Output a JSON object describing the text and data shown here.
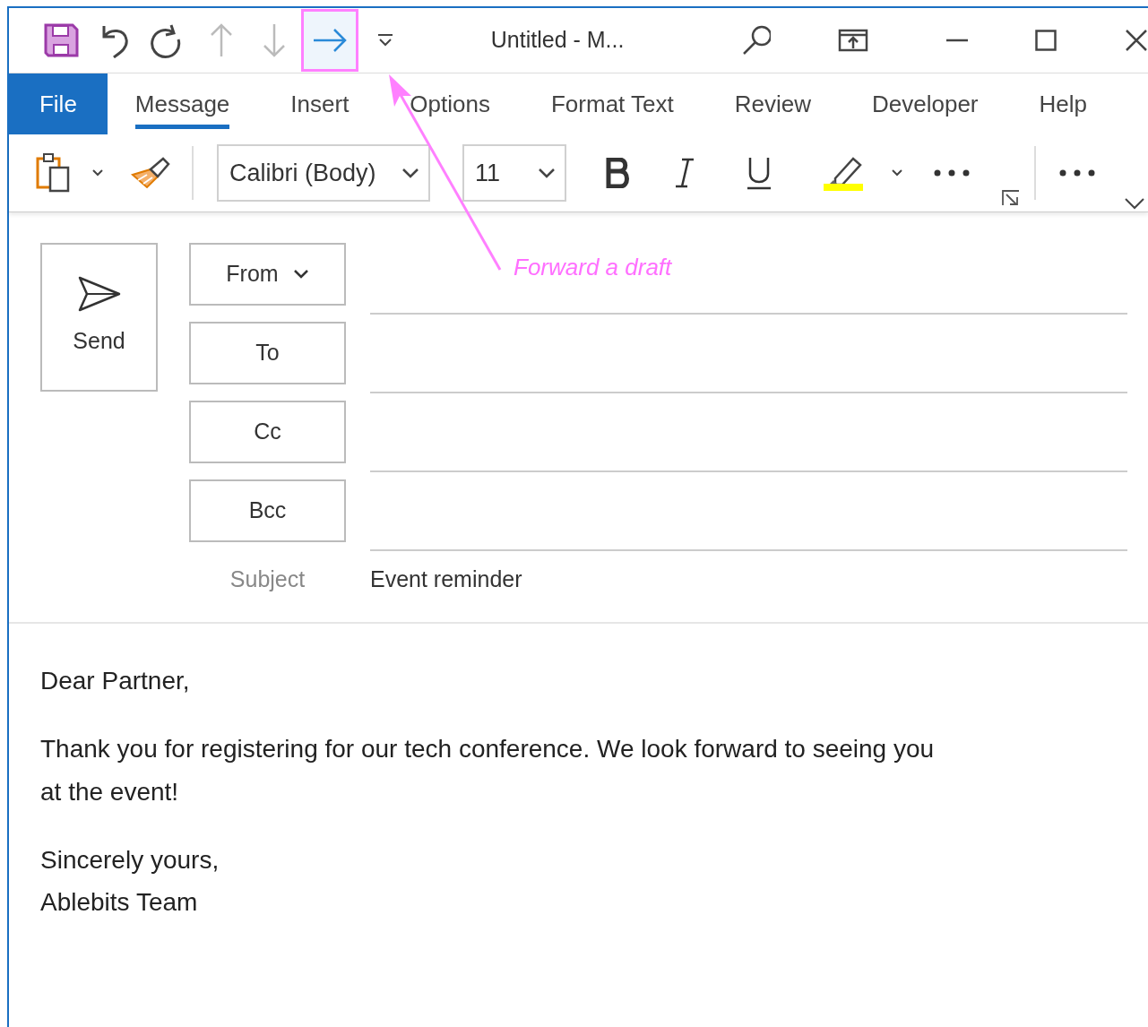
{
  "window": {
    "title": "Untitled  -  M..."
  },
  "quick_access": [
    {
      "kind": "save",
      "disabled": false,
      "highlighted": false
    },
    {
      "kind": "undo",
      "disabled": false,
      "highlighted": false
    },
    {
      "kind": "redo",
      "disabled": false,
      "highlighted": false
    },
    {
      "kind": "up",
      "disabled": true,
      "highlighted": false
    },
    {
      "kind": "down",
      "disabled": true,
      "highlighted": false
    },
    {
      "kind": "forward",
      "disabled": false,
      "highlighted": true
    },
    {
      "kind": "customize",
      "disabled": false,
      "highlighted": false
    }
  ],
  "tabs": [
    {
      "label": "File",
      "kind": "file",
      "selected": false
    },
    {
      "label": "Message",
      "kind": "tab",
      "selected": true
    },
    {
      "label": "Insert",
      "kind": "tab",
      "selected": false
    },
    {
      "label": "Options",
      "kind": "tab",
      "selected": false
    },
    {
      "label": "Format Text",
      "kind": "tab",
      "selected": false
    },
    {
      "label": "Review",
      "kind": "tab",
      "selected": false
    },
    {
      "label": "Developer",
      "kind": "tab",
      "selected": false
    },
    {
      "label": "Help",
      "kind": "tab",
      "selected": false
    }
  ],
  "ribbon": {
    "font": "Calibri (Body)",
    "size": "11"
  },
  "send_button": "Send",
  "address_fields": [
    {
      "label": "From",
      "kind": "dropdown"
    },
    {
      "label": "To",
      "kind": "button"
    },
    {
      "label": "Cc",
      "kind": "button"
    },
    {
      "label": "Bcc",
      "kind": "button"
    }
  ],
  "subject": {
    "label": "Subject",
    "value": "Event reminder"
  },
  "body": [
    {
      "lines": [
        "Dear Partner,"
      ]
    },
    {
      "lines": [
        "Thank you for registering for our tech conference. We look forward to seeing you at the event!"
      ]
    },
    {
      "lines": [
        "Sincerely yours,",
        "Ablebits Team"
      ]
    }
  ],
  "annotation": {
    "text": "Forward a draft"
  }
}
